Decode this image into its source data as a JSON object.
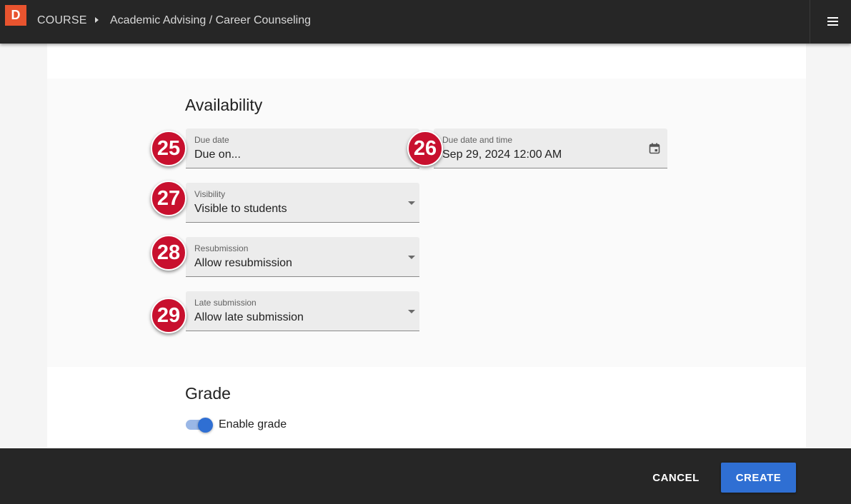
{
  "header": {
    "logo_letter": "D",
    "breadcrumb_root": "COURSE",
    "breadcrumb_title": "Academic Advising / Career Counseling",
    "menu_icon": "hamburger-menu-icon"
  },
  "availability": {
    "title": "Availability",
    "due_date": {
      "label": "Due date",
      "value": "Due on...",
      "badge": "25"
    },
    "due_date_time": {
      "label": "Due date and time",
      "value": "Sep 29, 2024 12:00 AM",
      "badge": "26",
      "icon": "calendar-icon"
    },
    "visibility": {
      "label": "Visibility",
      "value": "Visible to students",
      "badge": "27"
    },
    "resubmission": {
      "label": "Resubmission",
      "value": "Allow resubmission",
      "badge": "28"
    },
    "late_submission": {
      "label": "Late submission",
      "value": "Allow late submission",
      "badge": "29"
    }
  },
  "grade": {
    "title": "Grade",
    "enable_label": "Enable grade",
    "enabled": true
  },
  "footer": {
    "cancel_label": "CANCEL",
    "create_label": "CREATE"
  },
  "colors": {
    "accent": "#2f6fd3",
    "badge": "#c8102e",
    "logo": "#e8542f",
    "bar": "#262626"
  }
}
